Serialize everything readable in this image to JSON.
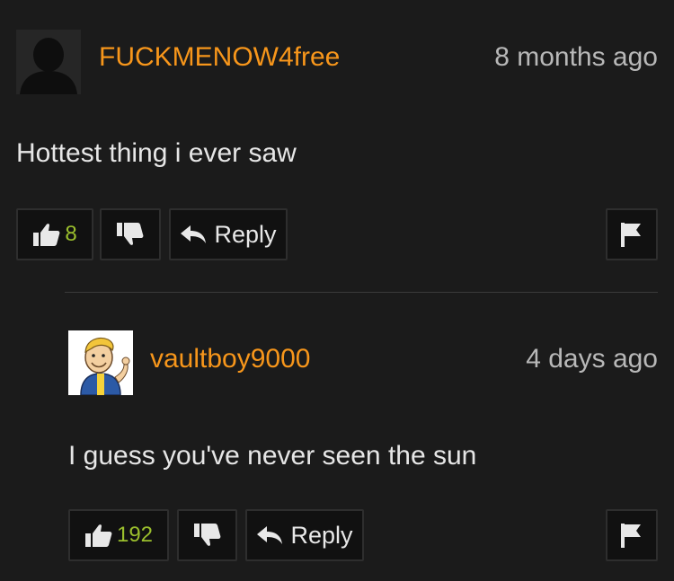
{
  "comments": [
    {
      "username": "FUCKMENOW4free",
      "timestamp": "8 months ago",
      "text": "Hottest thing i ever saw",
      "likes": "8",
      "reply_label": "Reply",
      "avatar": "default-silhouette-avatar"
    },
    {
      "username": "vaultboy9000",
      "timestamp": "4 days ago",
      "text": "I guess you've never seen the sun",
      "likes": "192",
      "reply_label": "Reply",
      "avatar": "vault-boy-avatar"
    }
  ],
  "icons": {
    "like": "thumbs-up-icon",
    "dislike": "thumbs-down-icon",
    "reply": "reply-arrow-icon",
    "flag": "flag-icon"
  },
  "colors": {
    "background": "#1b1b1b",
    "username": "#f7961b",
    "like_count": "#9bbf2d",
    "text": "#e6e6e6",
    "timestamp": "#b8b8b8"
  }
}
